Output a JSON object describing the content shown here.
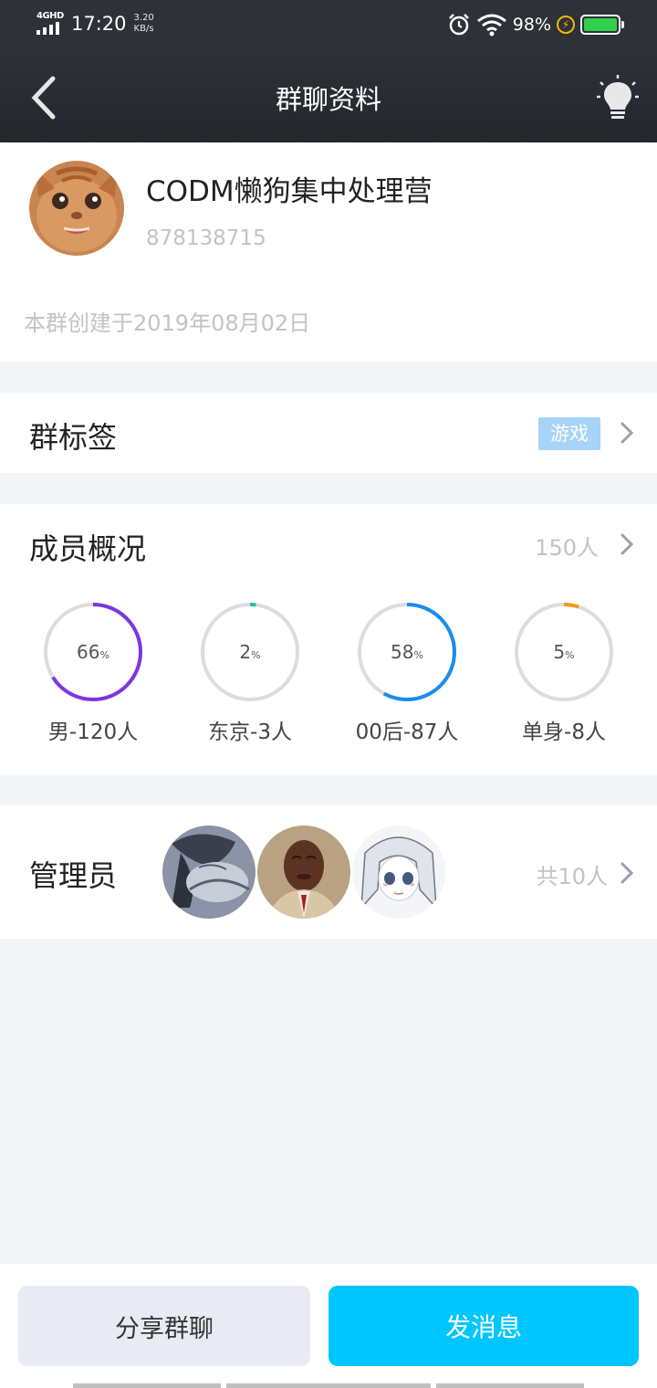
{
  "status_bar": {
    "network": "4GHD",
    "time": "17:20",
    "speed_value": "3.20",
    "speed_unit": "KB/s",
    "battery_pct": "98%",
    "battery_level": 0.98
  },
  "header": {
    "title": "群聊资料"
  },
  "group": {
    "name": "CODM懒狗集中处理营",
    "id": "878138715",
    "created": "本群创建于2019年08月02日"
  },
  "tags_row": {
    "label": "群标签",
    "tag": "游戏"
  },
  "members": {
    "label": "成员概况",
    "count": "150人",
    "stats": [
      {
        "pct": "66",
        "unit": "%",
        "fraction": 0.66,
        "label": "男-120人",
        "color": "#7b35e0"
      },
      {
        "pct": "2",
        "unit": "%",
        "fraction": 0.02,
        "label": "东京-3人",
        "color": "#18c7a3"
      },
      {
        "pct": "58",
        "unit": "%",
        "fraction": 0.58,
        "label": "00后-87人",
        "color": "#1a8cf0"
      },
      {
        "pct": "5",
        "unit": "%",
        "fraction": 0.05,
        "label": "单身-8人",
        "color": "#f39a13"
      }
    ]
  },
  "admins": {
    "label": "管理员",
    "count": "共10人"
  },
  "actions": {
    "share": "分享群聊",
    "send": "发消息"
  },
  "colors": {
    "header_bg": "#2e3138",
    "accent": "#00c6ff",
    "tag_bg": "#a7d3f7",
    "ring_track": "#dcdcdc"
  }
}
